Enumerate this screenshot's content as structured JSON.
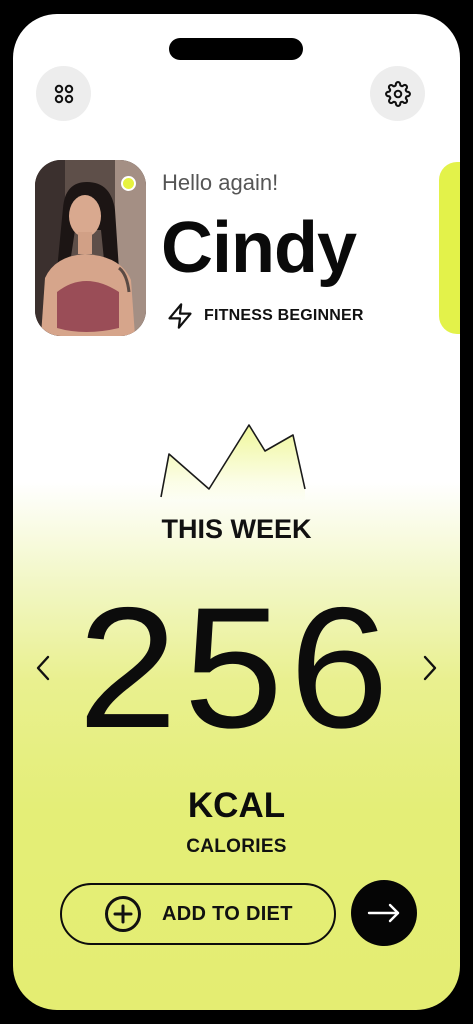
{
  "header": {
    "menu_icon": "grid-dots-icon",
    "settings_icon": "gear-icon"
  },
  "profile": {
    "greeting": "Hello again!",
    "name": "Cindy",
    "level_icon": "lightning-icon",
    "level": "FITNESS BEGINNER",
    "status_color": "#e6f23e"
  },
  "stats": {
    "title": "THIS WEEK",
    "value": "256",
    "unit": "KCAL",
    "metric": "CALORIES",
    "prev_icon": "chevron-left-icon",
    "next_icon": "chevron-right-icon"
  },
  "actions": {
    "add_label": "ADD TO DIET",
    "add_icon": "plus-circle-icon",
    "go_icon": "arrow-right-icon"
  },
  "theme": {
    "accent": "#e3f24a",
    "dark": "#0c0c0c"
  }
}
